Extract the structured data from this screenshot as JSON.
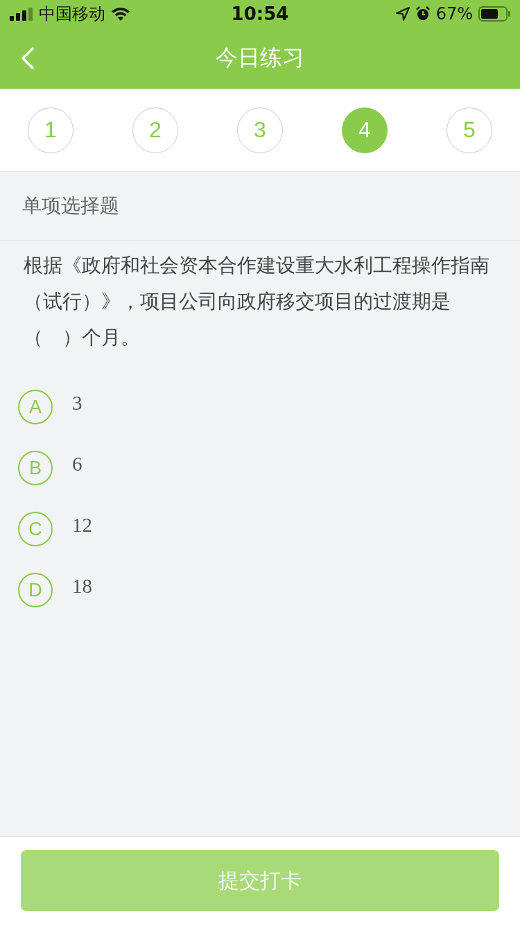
{
  "status_bar": {
    "carrier": "中国移动",
    "time": "10:54",
    "battery": "67%"
  },
  "nav_bar": {
    "title": "今日练习"
  },
  "question_numbers": [
    {
      "label": "1",
      "selected": false
    },
    {
      "label": "2",
      "selected": false
    },
    {
      "label": "3",
      "selected": false
    },
    {
      "label": "4",
      "selected": true
    },
    {
      "label": "5",
      "selected": false
    }
  ],
  "question_type": "单项选择题",
  "question": "根据《政府和社会资本合作建设重大水利工程操作指南（试行）》，项目公司向政府移交项目的过渡期是（　）个月。",
  "options": [
    {
      "letter": "A",
      "text": "3",
      "selected": false
    },
    {
      "letter": "B",
      "text": "6",
      "selected": false
    },
    {
      "letter": "C",
      "text": "12",
      "selected": false
    },
    {
      "letter": "D",
      "text": "18",
      "selected": false
    }
  ],
  "submit_button": {
    "label": "提交打卡",
    "disabled": true
  }
}
